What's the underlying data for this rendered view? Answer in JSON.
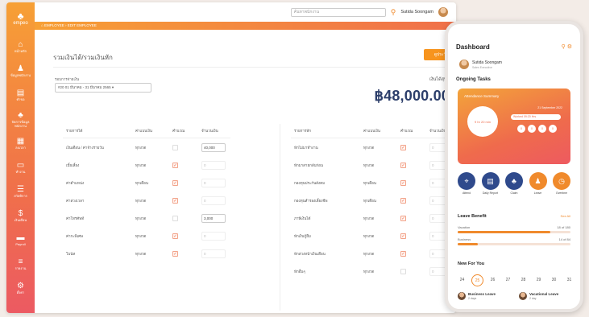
{
  "app": {
    "logo_text": "empeo"
  },
  "sidebar": {
    "items": [
      {
        "icon": "home-icon",
        "label": "หน้าหลัก"
      },
      {
        "icon": "person-icon",
        "label": "ข้อมูลพนักงาน"
      },
      {
        "icon": "document-icon",
        "label": "คำขอ"
      },
      {
        "icon": "people-icon",
        "label": "จัดการข้อมูล พนักงาน"
      },
      {
        "icon": "calendar-icon",
        "label": "ลงเวลา"
      },
      {
        "icon": "monitor-icon",
        "label": "ทำงาน"
      },
      {
        "icon": "list-icon",
        "label": "สวัสดิการ"
      },
      {
        "icon": "money-icon",
        "label": "เงินเดือน"
      },
      {
        "icon": "card-icon",
        "label": "Payroll"
      },
      {
        "icon": "report-icon",
        "label": "รายงาน"
      },
      {
        "icon": "settings-icon",
        "label": "ตั้งค่า"
      }
    ]
  },
  "topbar": {
    "search_placeholder": "ค้นหาพนักงาน",
    "user_name": "Sutida Soongam"
  },
  "breadcrumb": {
    "text": "⌂ EMPLOYEE  ›  EDIT EMPLOYEE"
  },
  "page": {
    "title": "รวมเงินได้/รวมเงินหัก",
    "action_button": "ดูประวัติการแก้ไข",
    "period_label": "รอบการจ่ายเงิน",
    "period_value": "#20 01 มีนาคม - 31 มีนาคม 2565 ▾",
    "net_label": "เงินได้สุทธิ",
    "net_value": "฿48,000.00"
  },
  "income_table": {
    "headers": [
      "รายการได้",
      "ค่าแบบเงิน",
      "คำนวณ",
      "จำนวนเงิน"
    ],
    "rows": [
      {
        "name": "เงินเดือน / ค่าจ้างรายวัน",
        "type": "ทุกงวด",
        "checked": false,
        "amount": "40,000"
      },
      {
        "name": "เบี้ยเลี้ยง",
        "type": "ทุกงวด",
        "checked": true,
        "amount": "0"
      },
      {
        "name": "ค่าตำแหน่ง",
        "type": "ทุกเดือน",
        "checked": true,
        "amount": "0"
      },
      {
        "name": "ค่าล่วงเวลา",
        "type": "ทุกงวด",
        "checked": true,
        "amount": "0"
      },
      {
        "name": "ค่าโทรศัพท์",
        "type": "ทุกงวด",
        "checked": false,
        "amount": "3,000"
      },
      {
        "name": "ค่ากะพิเศษ",
        "type": "ทุกงวด",
        "checked": true,
        "amount": "0"
      },
      {
        "name": "โบนัส",
        "type": "ทุกงวด",
        "checked": true,
        "amount": "0"
      }
    ]
  },
  "deduct_table": {
    "headers": [
      "รายการหัก",
      "ค่าแบบเงิน",
      "คำนวณ",
      "จำนวนเงิน"
    ],
    "rows": [
      {
        "name": "หักไม่มาทำงาน",
        "type": "ทุกงวด",
        "checked": true,
        "amount": "0"
      },
      {
        "name": "หักมาสายกลับก่อน",
        "type": "ทุกงวด",
        "checked": true,
        "amount": "0"
      },
      {
        "name": "กองทุนประกันสังคม",
        "type": "ทุกเดือน",
        "checked": true,
        "amount": "0"
      },
      {
        "name": "กองทุนสำรองเลี้ยงชีพ",
        "type": "ทุกเดือน",
        "checked": true,
        "amount": "0"
      },
      {
        "name": "ภาษีเงินได้",
        "type": "ทุกงวด",
        "checked": true,
        "amount": "0"
      },
      {
        "name": "หักเงินกู้ยืม",
        "type": "ทุกงวด",
        "checked": true,
        "amount": "0"
      },
      {
        "name": "หักล่วงหน้าเงินเดือน",
        "type": "ทุกงวด",
        "checked": true,
        "amount": "0"
      },
      {
        "name": "หักอื่นๆ",
        "type": "ทุกงวด",
        "checked": false,
        "amount": "0"
      }
    ]
  },
  "phone": {
    "title": "Dashboard",
    "user_name": "Sutida Soongam",
    "user_role": "Sales Executive",
    "ongoing_title": "Ongoing Tasks",
    "card_title": "Attendance Summary",
    "card_date": "21 September 2022",
    "clock_text": "9 hr 20 min",
    "pill_text": "Worked   09:20 Hrs",
    "circles": [
      "0",
      "0",
      "0",
      "0"
    ],
    "quick_actions": [
      {
        "label": "Attend",
        "icon": "location-icon",
        "color": "#2f4a8c"
      },
      {
        "label": "Daily Report",
        "icon": "document-icon",
        "color": "#2f4a8c"
      },
      {
        "label": "Claim",
        "icon": "people-icon",
        "color": "#2f4a8c"
      },
      {
        "label": "Leave",
        "icon": "person-icon",
        "color": "#f08a2c"
      },
      {
        "label": "Overtime",
        "icon": "clock-icon",
        "color": "#f08a2c"
      }
    ],
    "leave_title": "Leave Benefit",
    "leave_all": "See All",
    "leave_rows": [
      {
        "name": "Vacation",
        "count": "18 of 180",
        "fill": 0.82
      },
      {
        "name": "Business",
        "count": "14 of 84",
        "fill": 0.18
      }
    ],
    "nfy_title": "New For You",
    "dates": [
      "24",
      "25",
      "26",
      "27",
      "28",
      "29",
      "30",
      "31"
    ],
    "selected_date": 1,
    "leaves": [
      {
        "title": "Business Leave",
        "days": "2 days"
      },
      {
        "title": "Vacational Leave",
        "days": "2 day"
      }
    ]
  }
}
